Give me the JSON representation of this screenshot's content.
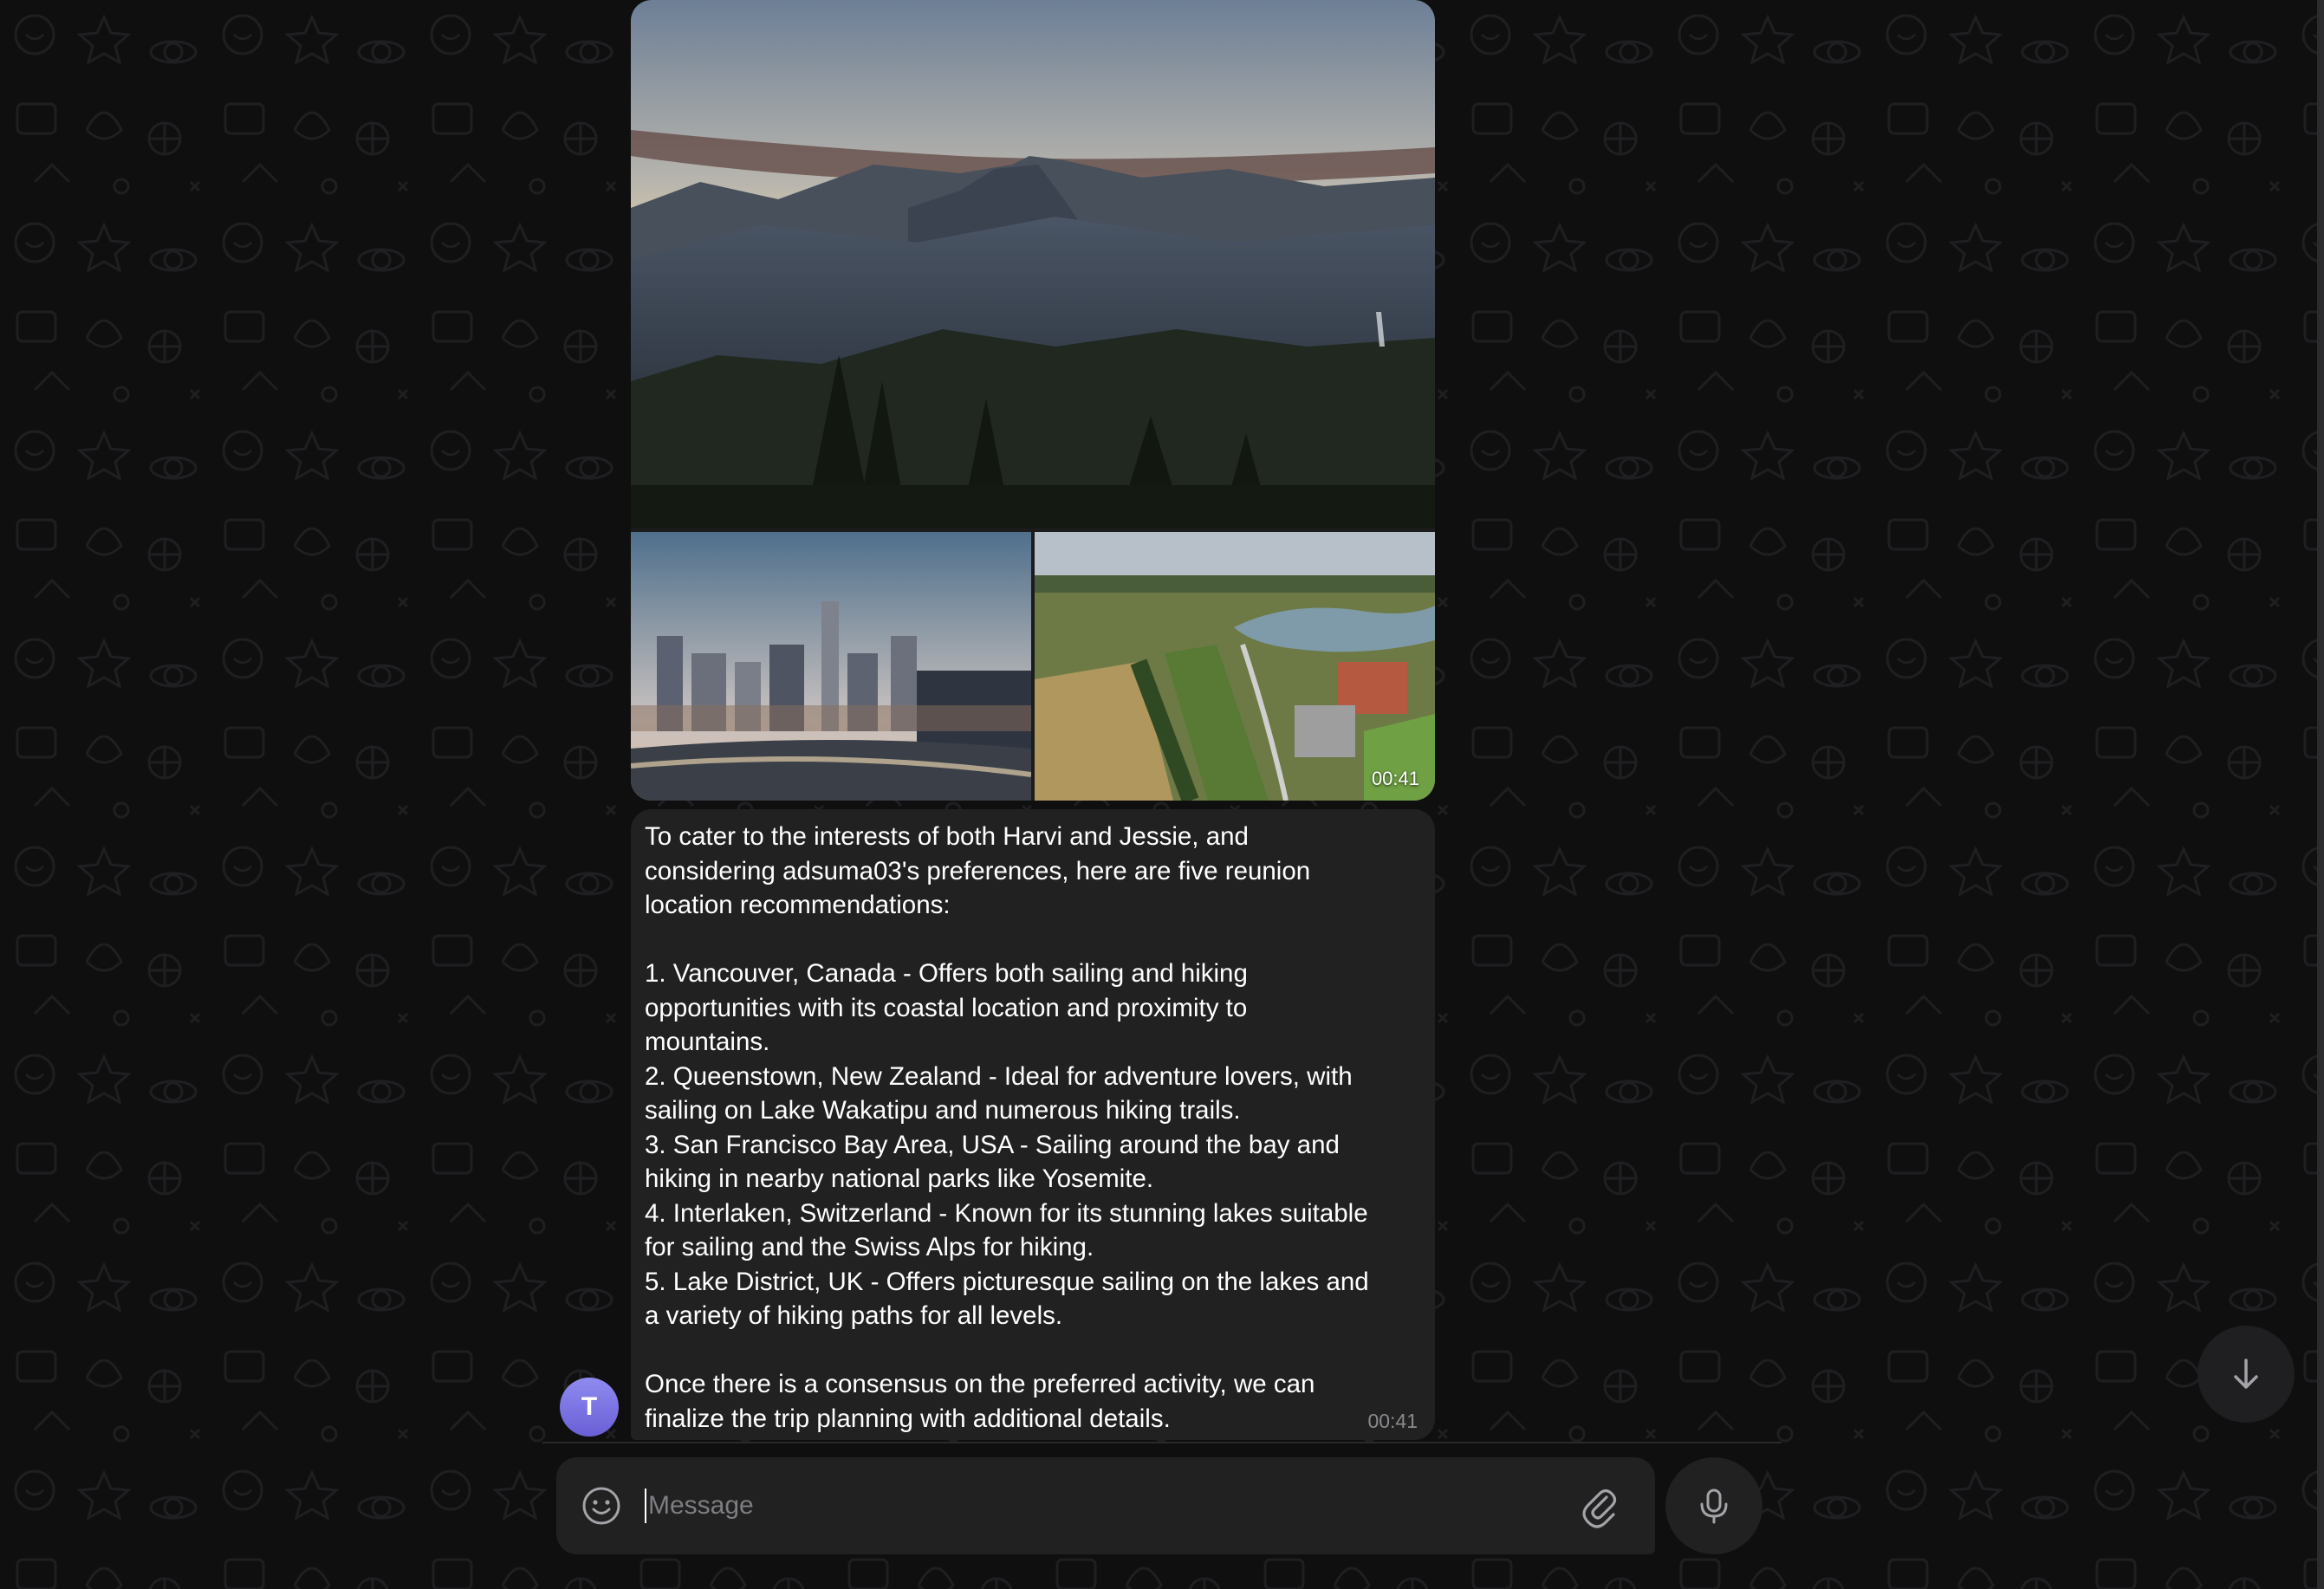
{
  "chat": {
    "media_time": "00:41",
    "message": {
      "text": "To cater to the interests of both Harvi and Jessie, and\nconsidering adsuma03's preferences, here are five reunion\nlocation recommendations:\n\n1. Vancouver, Canada - Offers both sailing and hiking\nopportunities with its coastal location and proximity to\nmountains.\n2. Queenstown, New Zealand - Ideal for adventure lovers, with\nsailing on Lake Wakatipu and numerous hiking trails.\n3. San Francisco Bay Area, USA - Sailing around the bay and\nhiking in nearby national parks like Yosemite.\n4. Interlaken, Switzerland - Known for its stunning lakes suitable\nfor sailing and the Swiss Alps for hiking.\n5. Lake District, UK - Offers picturesque sailing on the lakes and\na variety of hiking paths for all levels.\n\nOnce there is a consensus on the preferred activity, we can\nfinalize the trip planning with additional details.",
      "time": "00:41"
    },
    "sender": {
      "avatar_letter": "T",
      "avatar_color": "#7b72e0"
    }
  },
  "composer": {
    "placeholder": "Message",
    "value": "",
    "emoji_icon": "smiley-icon",
    "attach_icon": "paperclip-icon",
    "send_icon": "microphone-icon"
  },
  "scroll_button": {
    "icon": "arrow-down-icon"
  },
  "theme": {
    "background": "#0f0f10",
    "bubble": "#212121",
    "meta_text": "#8a8a8e"
  }
}
